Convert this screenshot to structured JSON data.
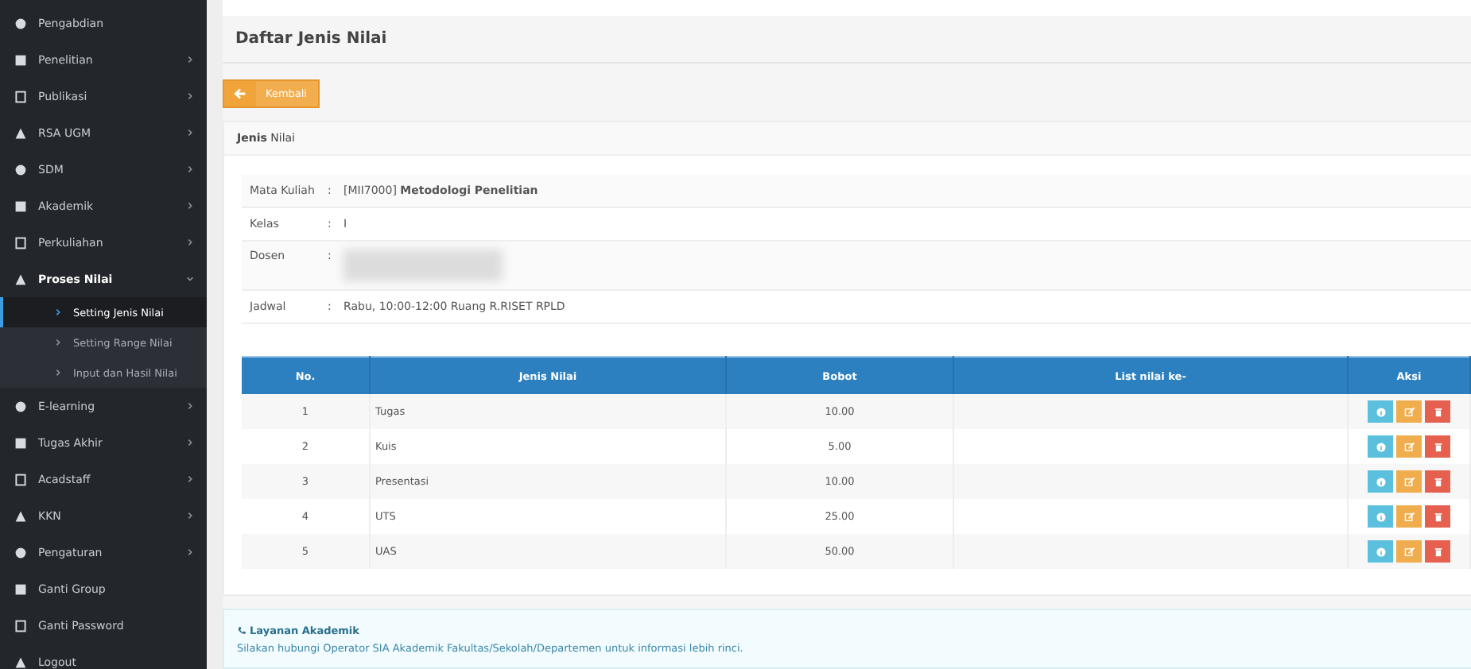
{
  "sidebar": {
    "items": [
      {
        "label": "Pengabdian",
        "expanded": false,
        "has_arrow": false
      },
      {
        "label": "Penelitian",
        "expanded": false,
        "has_arrow": true
      },
      {
        "label": "Publikasi",
        "expanded": false,
        "has_arrow": true
      },
      {
        "label": "RSA UGM",
        "expanded": false,
        "has_arrow": true
      },
      {
        "label": "SDM",
        "expanded": false,
        "has_arrow": true
      },
      {
        "label": "Akademik",
        "expanded": false,
        "has_arrow": true
      },
      {
        "label": "Perkuliahan",
        "expanded": false,
        "has_arrow": true
      },
      {
        "label": "Proses Nilai",
        "expanded": true,
        "has_arrow": true,
        "children": [
          {
            "label": "Setting Jenis Nilai",
            "selected": true
          },
          {
            "label": "Setting Range Nilai",
            "selected": false
          },
          {
            "label": "Input dan Hasil Nilai",
            "selected": false
          }
        ]
      },
      {
        "label": "E-learning",
        "expanded": false,
        "has_arrow": true
      },
      {
        "label": "Tugas Akhir",
        "expanded": false,
        "has_arrow": true
      },
      {
        "label": "Acadstaff",
        "expanded": false,
        "has_arrow": true
      },
      {
        "label": "KKN",
        "expanded": false,
        "has_arrow": true
      },
      {
        "label": "Pengaturan",
        "expanded": false,
        "has_arrow": true
      },
      {
        "label": "Ganti Group",
        "expanded": false,
        "has_arrow": false
      },
      {
        "label": "Ganti Password",
        "expanded": false,
        "has_arrow": false
      },
      {
        "label": "Logout",
        "expanded": false,
        "has_arrow": false
      }
    ]
  },
  "page_title": "Daftar Jenis Nilai",
  "back_button": "Kembali",
  "panel_title": "**Jenis** Nilai",
  "info": [
    {
      "label": "Mata Kuliah",
      "sep": ":",
      "value": "[MII7000] **Metodologi Penelitian**",
      "redacted": false
    },
    {
      "label": "Kelas",
      "sep": ":",
      "value": "I",
      "redacted": false
    },
    {
      "label": "Dosen",
      "sep": ":",
      "redacted": true
    },
    {
      "label": "Jadwal",
      "sep": ":",
      "value": "Rabu, 10:00-12:00 Ruang R.RISET RPLD",
      "redacted": false
    }
  ],
  "table": {
    "columns": [
      "No.",
      "Jenis Nilai",
      "Bobot",
      "List nilai ke-",
      "Aksi"
    ],
    "rows": [
      {
        "no": "1",
        "name": "Tugas",
        "bobot": "10.00"
      },
      {
        "no": "2",
        "name": "Kuis",
        "bobot": "5.00"
      },
      {
        "no": "3",
        "name": "Presentasi",
        "bobot": "10.00"
      },
      {
        "no": "4",
        "name": "UTS",
        "bobot": "25.00"
      },
      {
        "no": "5",
        "name": "UAS",
        "bobot": "50.00"
      }
    ]
  },
  "notice": {
    "title": "Layanan Akademik",
    "text": "Silakan hubungi Operator SIA Akademik Fakultas/Sekolah/Departemen untuk informasi lebih rinci."
  }
}
